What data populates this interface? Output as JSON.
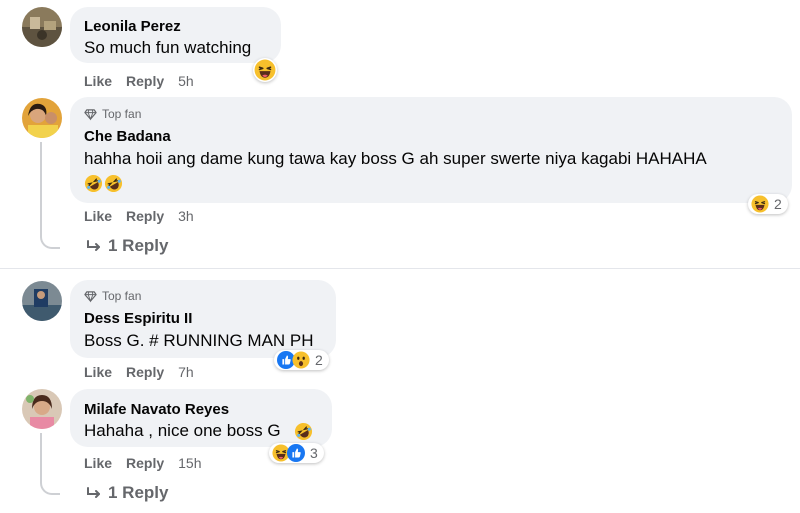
{
  "comments": [
    {
      "author": "Leonila Perez",
      "text": "So much fun watching",
      "like": "Like",
      "reply": "Reply",
      "time": "5h"
    },
    {
      "badge": "Top fan",
      "author": "Che Badana",
      "text": "hahha hoii ang dame kung tawa kay boss G ah super swerte niya kagabi HAHAHA",
      "like": "Like",
      "reply": "Reply",
      "time": "3h",
      "reaction_count": "2",
      "replies_label": "1 Reply"
    },
    {
      "badge": "Top fan",
      "author": "Dess Espiritu II",
      "text": "Boss G. # RUNNING MAN PH",
      "like": "Like",
      "reply": "Reply",
      "time": "7h",
      "reaction_count": "2"
    },
    {
      "author": "Milafe Navato Reyes",
      "text": "Hahaha , nice one boss G",
      "like": "Like",
      "reply": "Reply",
      "time": "15h",
      "reaction_count": "3",
      "replies_label": "1 Reply"
    }
  ],
  "colors": {
    "bubble": "#f0f2f5",
    "secondary_text": "#65676b",
    "like_blue": "#1877f2",
    "emoji_yellow": "#f7c02c"
  },
  "icons": [
    "haha-icon",
    "rofl-icon",
    "like-icon",
    "wow-icon",
    "top-fan-icon",
    "reply-arrow-icon"
  ]
}
